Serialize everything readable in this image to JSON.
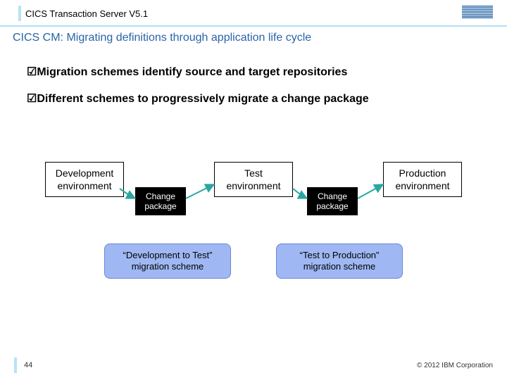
{
  "header": {
    "product": "CICS Transaction Server V5.1",
    "logo_alt": "IBM"
  },
  "title": "CICS CM: Migrating definitions through application life cycle",
  "bullets": [
    "Migration schemes identify source and target repositories",
    "Different schemes to progressively migrate a change package"
  ],
  "diagram": {
    "environments": {
      "dev": "Development\nenvironment",
      "test": "Test\nenvironment",
      "prod": "Production\nenvironment"
    },
    "change_package_label": "Change\npackage",
    "schemes": {
      "dev_to_test": "“Development to Test”\nmigration scheme",
      "test_to_prod": "“Test to Production”\nmigration scheme"
    }
  },
  "footer": {
    "page": "44",
    "copyright": "© 2012 IBM Corporation"
  }
}
